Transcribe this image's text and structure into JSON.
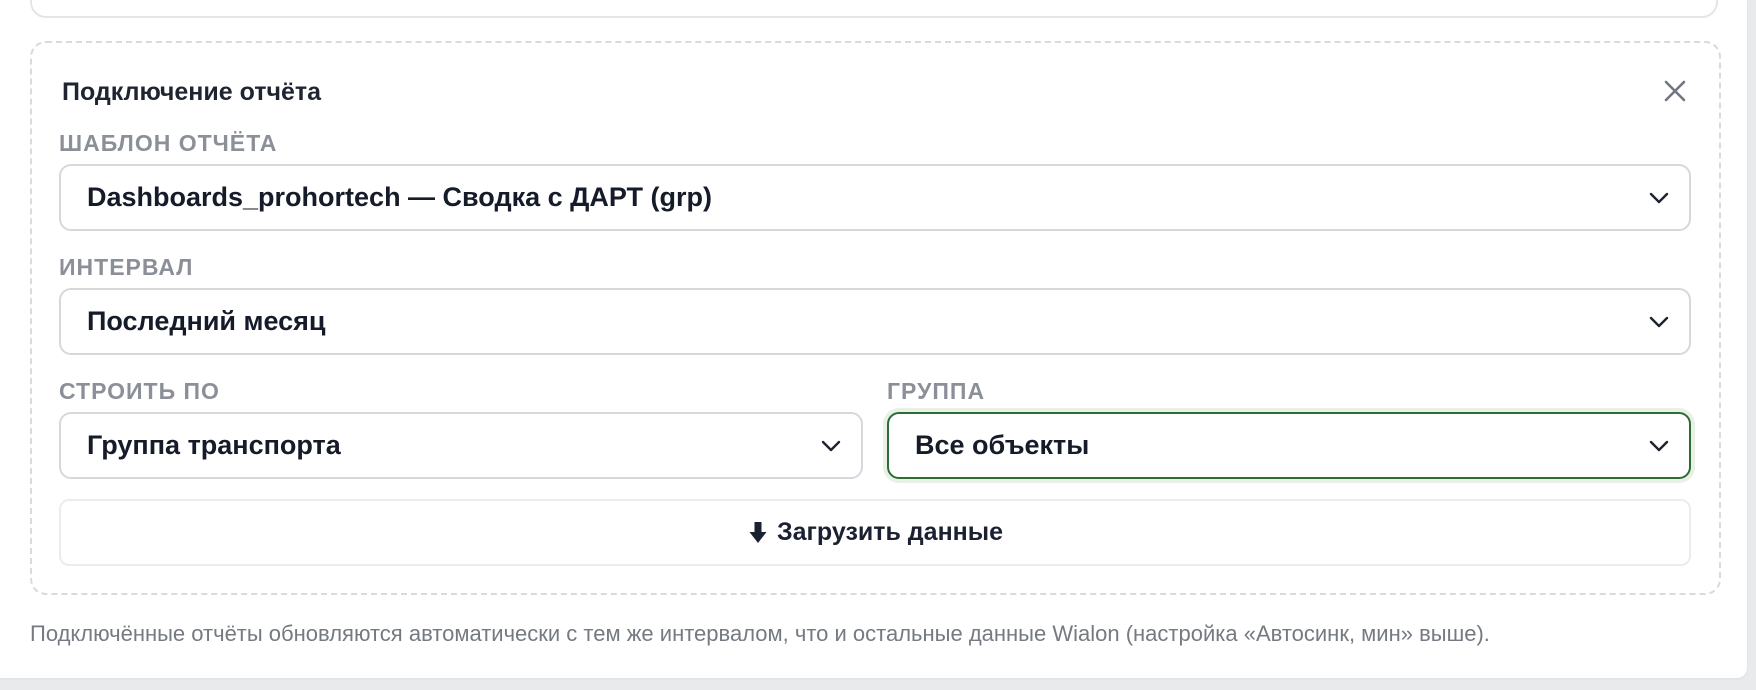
{
  "panel": {
    "title": "Подключение отчёта",
    "close_icon": "close-icon"
  },
  "template_field": {
    "label": "ШАБЛОН ОТЧЁТА",
    "value": "Dashboards_prohortech — Сводка с ДАРТ (grp)"
  },
  "interval_field": {
    "label": "ИНТЕРВАЛ",
    "value": "Последний месяц"
  },
  "build_by_field": {
    "label": "СТРОИТЬ ПО",
    "value": "Группа транспорта"
  },
  "group_field": {
    "label": "ГРУППА",
    "value": "Все объекты"
  },
  "load_button": {
    "icon": "download-arrow-icon",
    "label": "Загрузить данные"
  },
  "footer": {
    "note": "Подключённые отчёты обновляются автоматически с тем же интервалом, что и остальные данные Wialon (настройка «Автосинк, мин» выше)."
  },
  "colors": {
    "focus_border": "#2f6b34",
    "label_gray": "#8b9098",
    "text_dark": "#151b29"
  }
}
